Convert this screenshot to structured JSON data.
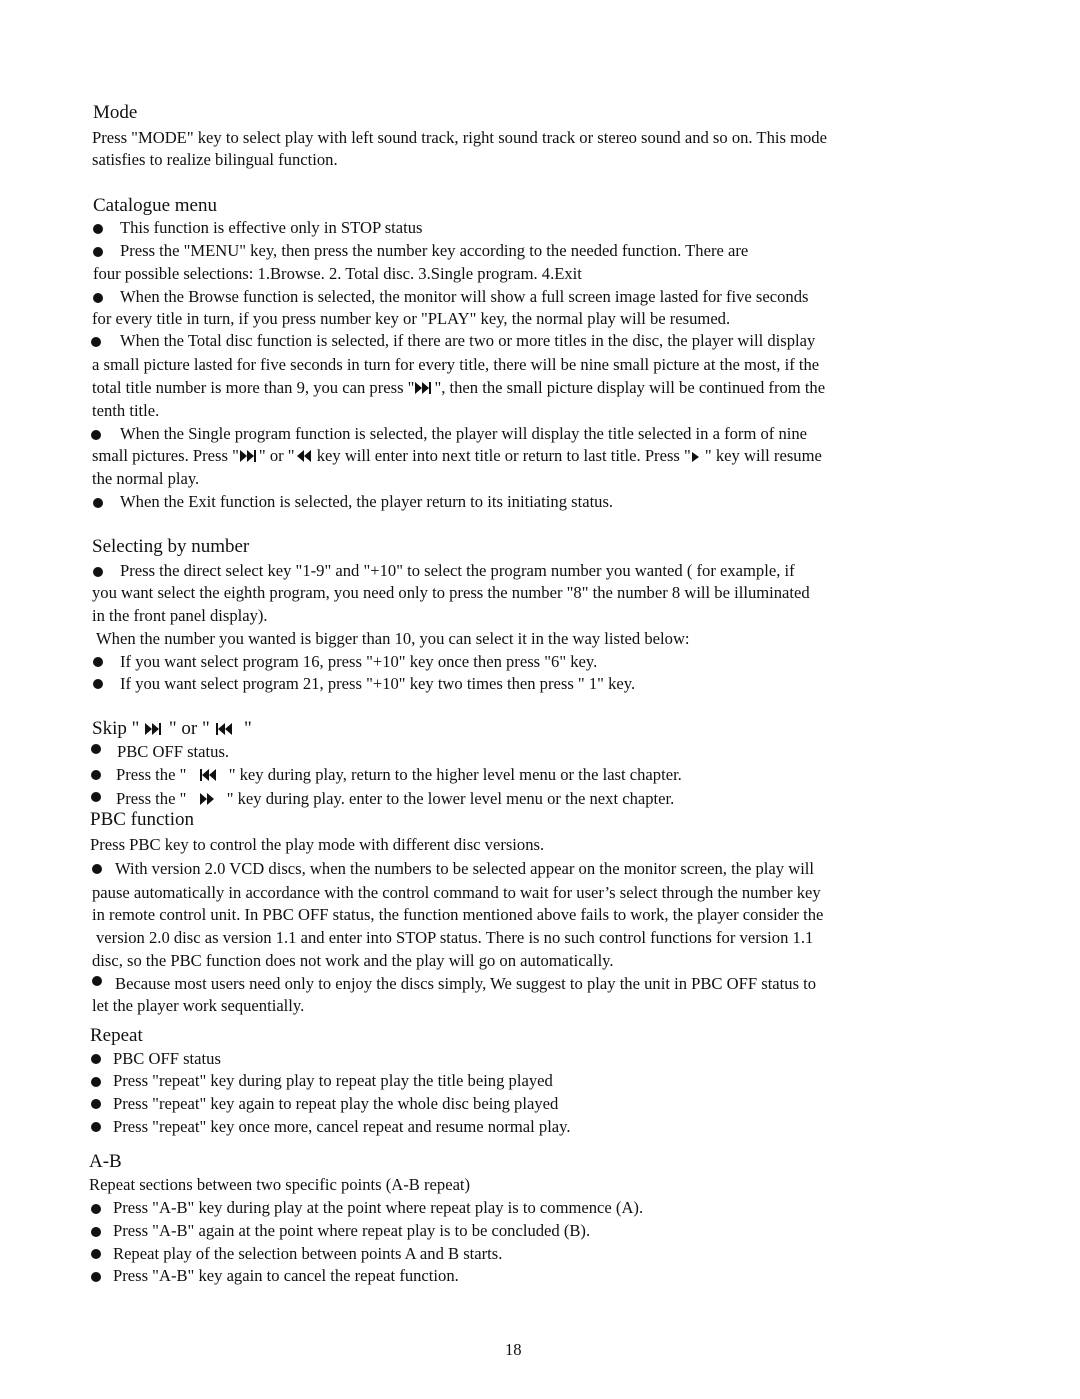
{
  "sections": {
    "mode": {
      "title": "Mode",
      "lines": [
        "Press \"MODE\" key to select play with left sound track, right sound track or stereo sound and so on. This mode",
        "satisfies to realize bilingual function."
      ]
    },
    "catalogue": {
      "title": "Catalogue menu",
      "lines": [
        "This function is effective only in STOP status",
        "Press the \"MENU\" key, then press the number key according to the needed function. There are",
        "four possible selections: 1.Browse. 2. Total disc. 3.Single program. 4.Exit",
        "When the Browse function is selected, the monitor will show a full screen image lasted for five seconds",
        "for every title in turn, if you press number key or \"PLAY\" key, the normal play will be resumed.",
        "When the Total disc function is selected, if there are two or more titles in the disc, the player will display",
        "a small picture lasted for five seconds in turn for every title, there will be nine small picture at the most, if the",
        "total title number is more than 9, you can press \"",
        "\", then the small picture display will be continued from the",
        "tenth title.",
        "When the Single program function is selected, the player will display the title selected in a form of nine",
        "small pictures. Press \"",
        "\" or \"",
        " key will enter into next title or return to last title. Press \"",
        " \" key will resume",
        "the normal play.",
        "When the Exit function is selected, the player return to its initiating status."
      ]
    },
    "selecting": {
      "title": "Selecting by number",
      "lines": [
        "Press the direct select key \"1-9\" and \"+10\" to select the program number you wanted ( for example, if",
        "you want select the eighth program, you need only to press the number \"8\" the number 8 will be illuminated",
        "in the front panel display).",
        "When the number you wanted is bigger than 10, you can select it in the way listed below:",
        "If you want select program 16, press \"+10\" key once then press \"6\" key.",
        "If you want select program 21, press \"+10\" key two times then press \" 1\" key."
      ]
    },
    "skip": {
      "title_prefix": "Skip \"",
      "title_mid": "\" or \"",
      "title_suffix": "\"",
      "lines": [
        "PBC OFF status.",
        "Press the \"",
        "\" key during play, return to the higher level menu or the last chapter.",
        "Press the \"",
        "\" key during play. enter to the lower level menu or the next chapter."
      ]
    },
    "pbc": {
      "title": "PBC function",
      "lines": [
        "Press PBC key to control the play mode with different disc versions.",
        "With version 2.0 VCD discs, when the numbers to be selected appear on the monitor screen, the play will",
        "pause automatically in accordance with the control command to wait for user’s select through the number key",
        "in remote control unit. In PBC OFF status, the function mentioned above fails to work, the player consider the",
        "version 2.0 disc as version 1.1 and enter into STOP status. There is no such control functions for version 1.1",
        "disc, so the PBC function does not work and the play will go on automatically.",
        "Because most users need only to enjoy the discs simply, We suggest to play the unit in PBC OFF status to",
        "let the player work sequentially."
      ]
    },
    "repeat": {
      "title": "Repeat",
      "lines": [
        "PBC OFF status",
        "Press \"repeat\" key during play to repeat play the title being played",
        "Press \"repeat\" key again to repeat play the whole disc being played",
        "Press \"repeat\" key once more, cancel repeat and resume normal play."
      ]
    },
    "ab": {
      "title": "A-B",
      "lines": [
        "Repeat sections between two specific points (A-B repeat)",
        "Press \"A-B\" key during play at the point where repeat play is to commence (A).",
        "Press \"A-B\" again at the point where repeat play is to be concluded (B).",
        "Repeat play of the selection between points A and B starts.",
        "Press \"A-B\" key again to cancel the repeat function."
      ]
    }
  },
  "icons": {
    "next": "skip-next-icon",
    "prev": "skip-previous-icon",
    "rewind": "fast-rewind-icon",
    "play": "play-icon",
    "forward": "fast-forward-icon"
  },
  "page_number": "18"
}
